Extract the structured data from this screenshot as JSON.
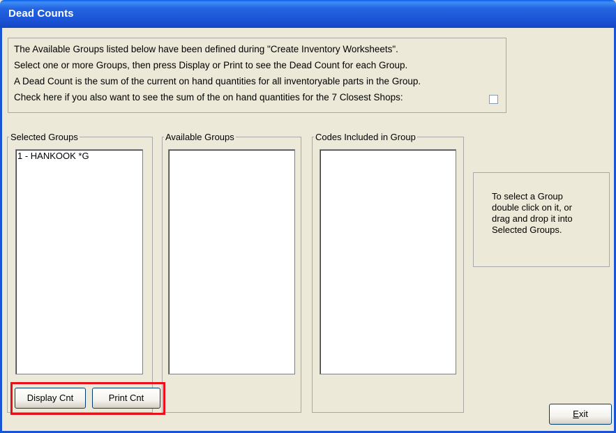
{
  "window": {
    "title": "Dead Counts"
  },
  "info": {
    "lines": [
      "The Available Groups listed below have been defined during \"Create Inventory Worksheets\".",
      "Select one or more Groups, then press Display or Print to see the Dead Count for each Group.",
      "A Dead Count is the sum of the current on hand quantities for all inventoryable parts in the Group.",
      "Check here if you also want to see the sum of the on hand quantities for the 7 Closest Shops:"
    ],
    "closest_shops_checked": false
  },
  "panels": {
    "selected": {
      "label": "Selected Groups",
      "items": [
        "1 - HANKOOK *G"
      ]
    },
    "available": {
      "label": "Available Groups",
      "items": []
    },
    "codes": {
      "label": "Codes Included in Group",
      "items": []
    }
  },
  "buttons": {
    "display": "Display Cnt",
    "print": "Print Cnt",
    "exit_prefix": "E",
    "exit_rest": "xit"
  },
  "hint": "To select a Group\ndouble click on it, or\ndrag and drop  it into\nSelected Groups."
}
